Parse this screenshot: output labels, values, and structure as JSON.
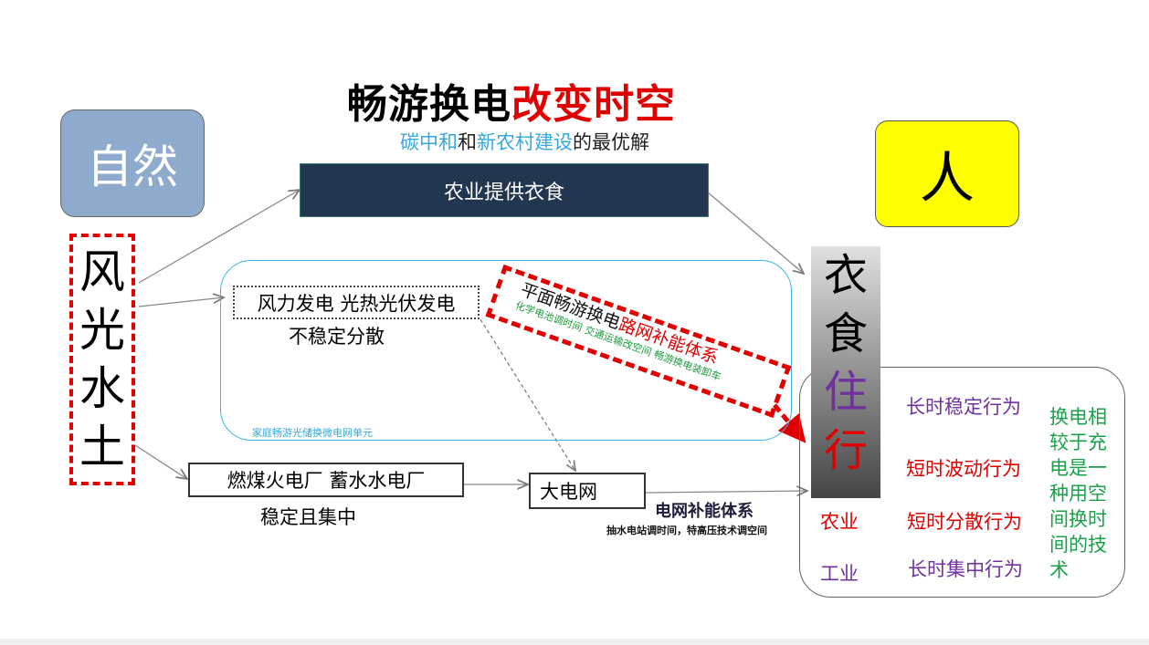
{
  "title": {
    "part1": "畅游换电",
    "part2": "改变时空",
    "color1": "#000000",
    "color2": "#e00000"
  },
  "subtitle": {
    "p1": "碳中和",
    "p2": "和",
    "p3": "新农村建设",
    "p4": "的最优解",
    "accent": "#35a8e0"
  },
  "nature_box": {
    "label": "自然",
    "bg": "#8eaacd"
  },
  "person_box": {
    "label": "人",
    "bg": "#ffff00"
  },
  "resources": [
    "风",
    "光",
    "水",
    "土"
  ],
  "agri_box": {
    "label": "农业提供衣食",
    "bg": "#223650"
  },
  "microgrid_label": "家庭畅游光储换微电网单元",
  "wind_box": {
    "label": "风力发电 光热光伏发电",
    "caption": "不稳定分散"
  },
  "coal_box": {
    "label": "燃煤火电厂   蓄水水电厂",
    "caption": "稳定且集中"
  },
  "grid_box": {
    "label": "大电网"
  },
  "grid_supplement": {
    "title": "电网补能体系",
    "sub": "抽水电站调时间，特高压技术调空间"
  },
  "road_network": {
    "line1_black": "平面畅游换电",
    "line1_red": "路网补能体系",
    "line2": "化学电池调时间 交通运输改空间   畅游换电装卸车"
  },
  "needs": [
    {
      "char": "衣",
      "color": "#000000"
    },
    {
      "char": "食",
      "color": "#000000"
    },
    {
      "char": "住",
      "color": "#7030a0"
    },
    {
      "char": "行",
      "color": "#e00000"
    }
  ],
  "sectors": [
    {
      "label": "农业",
      "color": "#e00000"
    },
    {
      "label": "工业",
      "color": "#7030a0"
    }
  ],
  "behaviors": [
    {
      "label": "长时稳定行为",
      "color": "#7030a0"
    },
    {
      "label": "短时波动行为",
      "color": "#e00000"
    },
    {
      "label": "短时分散行为",
      "color": "#e00000"
    },
    {
      "label": "长时集中行为",
      "color": "#7030a0"
    }
  ],
  "conclusion": "换电相较于充电是一种用空间换时间的技术",
  "conclusion_color": "#1aa04a"
}
